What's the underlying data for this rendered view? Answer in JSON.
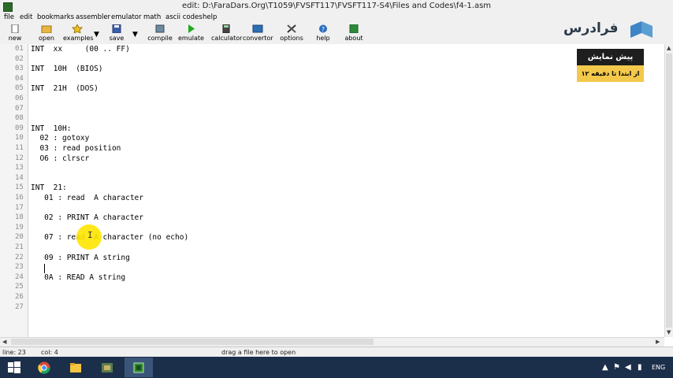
{
  "window": {
    "title": "edit: D:\\FaraDars.Org\\T1059\\FVSFT117\\FVSFT117-S4\\Files and Codes\\f4-1.asm"
  },
  "menu": [
    "file",
    "edit",
    "bookmarks",
    "assembler",
    "emulator",
    "math",
    "ascii codes",
    "help"
  ],
  "toolbar": {
    "new": "new",
    "open": "open",
    "examples": "examples",
    "save": "save",
    "compile": "compile",
    "emulate": "emulate",
    "calculator": "calculator",
    "convertor": "convertor",
    "options": "options",
    "help": "help",
    "about": "about"
  },
  "editor": {
    "lines": [
      {
        "num": "01",
        "text": "INT  xx     (00 .. FF)"
      },
      {
        "num": "02",
        "text": ""
      },
      {
        "num": "03",
        "text": "INT  10H  (BIOS)"
      },
      {
        "num": "04",
        "text": ""
      },
      {
        "num": "05",
        "text": "INT  21H  (DOS)"
      },
      {
        "num": "06",
        "text": ""
      },
      {
        "num": "07",
        "text": ""
      },
      {
        "num": "08",
        "text": ""
      },
      {
        "num": "09",
        "text": "INT  10H:"
      },
      {
        "num": "10",
        "text": "  02 : gotoxy"
      },
      {
        "num": "11",
        "text": "  03 : read position"
      },
      {
        "num": "12",
        "text": "  O6 : clrscr"
      },
      {
        "num": "13",
        "text": ""
      },
      {
        "num": "14",
        "text": ""
      },
      {
        "num": "15",
        "text": "INT  21:"
      },
      {
        "num": "16",
        "text": "   01 : read  A character"
      },
      {
        "num": "17",
        "text": ""
      },
      {
        "num": "18",
        "text": "   02 : PRINT A character"
      },
      {
        "num": "19",
        "text": ""
      },
      {
        "num": "20",
        "text": "   07 : read  A character (no echo)"
      },
      {
        "num": "21",
        "text": ""
      },
      {
        "num": "22",
        "text": "   09 : PRINT A string"
      },
      {
        "num": "23",
        "text": ""
      },
      {
        "num": "24",
        "text": "   0A : READ A string"
      },
      {
        "num": "25",
        "text": ""
      },
      {
        "num": "26",
        "text": ""
      },
      {
        "num": "27",
        "text": ""
      }
    ]
  },
  "status": {
    "line": "line: 23",
    "col": "col: 4",
    "hint": "drag a file here to open"
  },
  "overlay": {
    "logo": "فرادرس",
    "badge_title": "پیش نمایش",
    "badge_sub": "از ابتدا تا دقیقه ۱۲"
  },
  "taskbar": {
    "lang": "ENG"
  },
  "colors": {
    "taskbar": "#1c2f4a",
    "badge_dark": "#1e1e1e",
    "badge_yellow": "#f3c84b",
    "cursor_highlight": "#ffe600"
  }
}
